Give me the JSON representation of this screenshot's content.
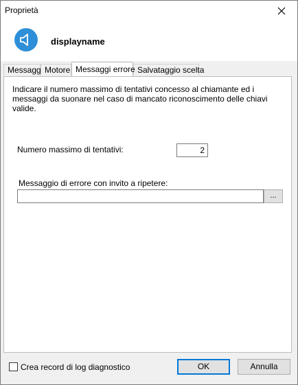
{
  "window": {
    "title": "Proprietà"
  },
  "header": {
    "name": "displayname",
    "icon": "speaker-icon",
    "icon_color": "#2e8fd8"
  },
  "tabs": [
    {
      "label": "Messaggi"
    },
    {
      "label": "Motore"
    },
    {
      "label": "Messaggi errore"
    },
    {
      "label": "Salvataggio scelta"
    }
  ],
  "active_tab": "Messaggi errore",
  "panel": {
    "description": "Indicare il numero massimo di tentativi concesso al chiamante ed i messaggi da suonare nel caso di mancato riconoscimento delle chiavi valide.",
    "max_attempts_label": "Numero massimo di tentativi:",
    "max_attempts_value": "2",
    "error_message_label": "Messaggio di errore con invito a ripetere:",
    "error_message_value": "",
    "browse_label": "..."
  },
  "footer": {
    "log_checkbox_label": "Crea record di log diagnostico",
    "log_checked": false,
    "ok_label": "OK",
    "cancel_label": "Annulla"
  },
  "colors": {
    "accent": "#0078d7"
  }
}
